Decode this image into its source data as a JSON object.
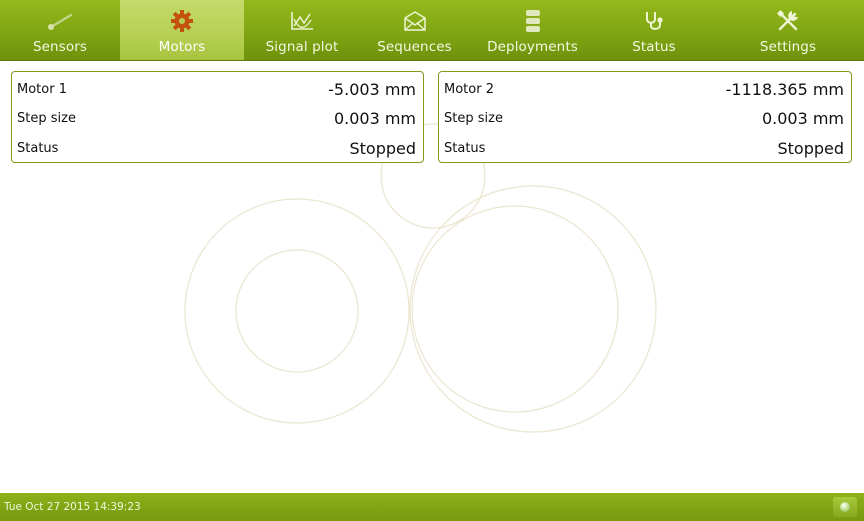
{
  "nav": {
    "items": [
      {
        "label": "Sensors",
        "icon": "sensor-probe-icon"
      },
      {
        "label": "Motors",
        "icon": "gear-icon"
      },
      {
        "label": "Signal plot",
        "icon": "chart-icon"
      },
      {
        "label": "Sequences",
        "icon": "envelope-icon"
      },
      {
        "label": "Deployments",
        "icon": "database-icon"
      },
      {
        "label": "Status",
        "icon": "stethoscope-icon"
      },
      {
        "label": "Settings",
        "icon": "tools-icon"
      }
    ],
    "active": "Motors"
  },
  "motors": [
    {
      "name": "Motor 1",
      "position": "-5.003 mm",
      "step_label": "Step size",
      "step_size": "0.003 mm",
      "status_label": "Status",
      "status": "Stopped"
    },
    {
      "name": "Motor 2",
      "position": "-1118.365 mm",
      "step_label": "Step size",
      "step_size": "0.003 mm",
      "status_label": "Status",
      "status": "Stopped"
    }
  ],
  "statusbar": {
    "datetime": "Tue Oct 27 2015 14:39:23",
    "indicator": "status-led-icon"
  },
  "colors": {
    "nav_green": "#7fa513",
    "nav_active": "#b6cf52",
    "accent_orange": "#c4520f",
    "panel_border": "#7f9b20",
    "watermark": "#ece6d3"
  }
}
